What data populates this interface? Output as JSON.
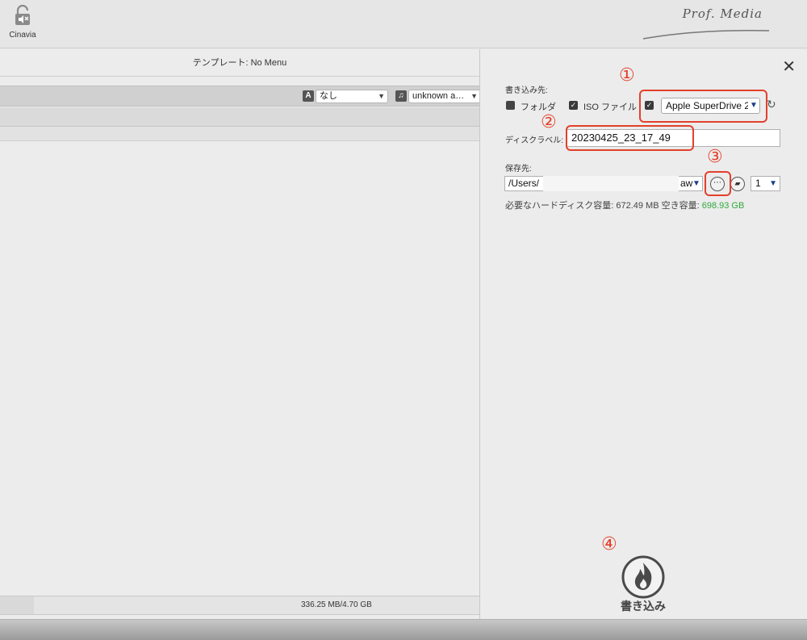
{
  "topbar": {
    "cinavia_label": "Cinavia",
    "brand": "Prof. Media"
  },
  "left": {
    "template_label": "テンプレート: No Menu",
    "subtitle_select": "なし",
    "subtitle_icon": "A",
    "audio_select": "unknown a…",
    "audio_icon": "music-note-icon",
    "capacity_text": "336.25 MB/4.70 GB",
    "capacity_fraction": 0.07
  },
  "right": {
    "write_to_label": "書き込み先:",
    "folder_label": "フォルダ",
    "iso_label": "ISO ファイル",
    "drive_value": "Apple SuperDrive 2",
    "disc_label_caption": "ディスクラベル:",
    "disc_label_value": "20230425_23_17_49",
    "save_to_label": "保存先:",
    "path_value": "/Users/",
    "path_tail": "aw",
    "copies_value": "1",
    "hdd_required": "必要なハードディスク容量: 672.49 MB",
    "hdd_free_label": "空き容量:",
    "hdd_free_value": "698.93 GB",
    "burn_label": "書き込み"
  },
  "annotations": {
    "n1": "①",
    "n2": "②",
    "n3": "③",
    "n4": "④",
    "color": "#e3402a"
  },
  "colors": {
    "free_space": "#2eaa3c",
    "panel": "#ececec"
  }
}
